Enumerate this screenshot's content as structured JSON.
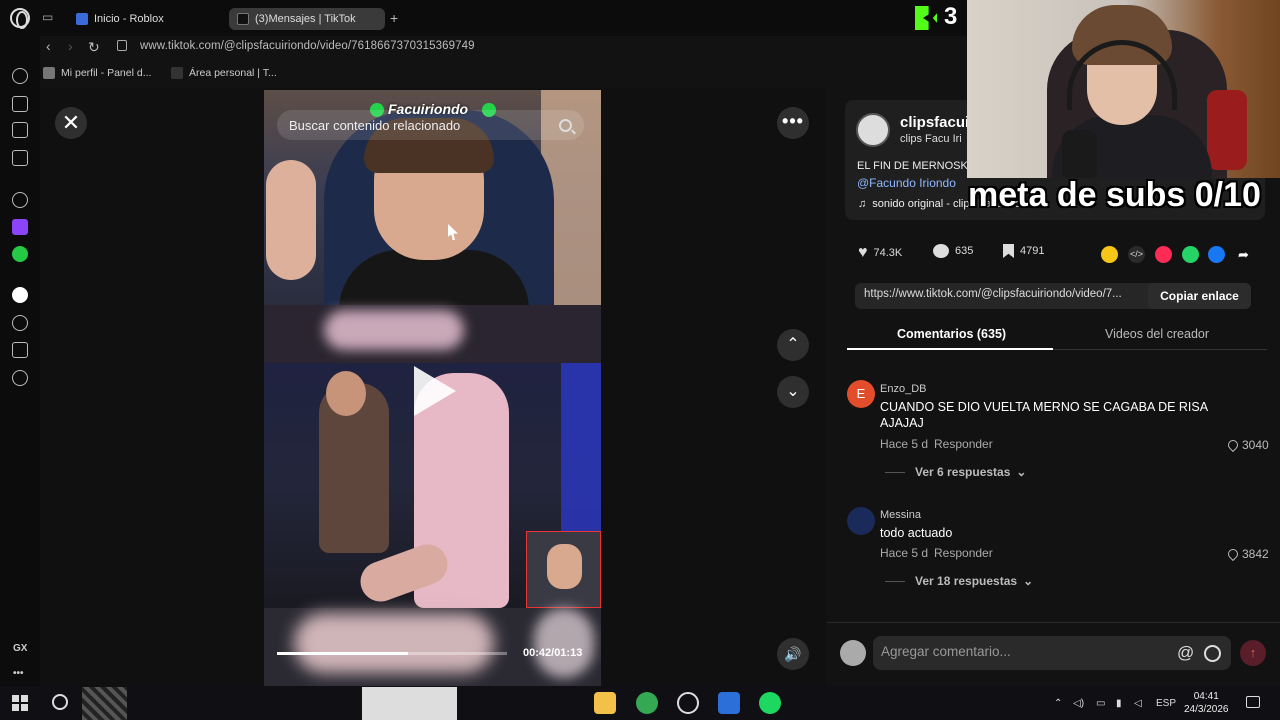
{
  "browser": {
    "tabs": [
      {
        "label": "Inicio - Roblox"
      },
      {
        "label": "(3)Mensajes | TikTok"
      }
    ],
    "new_tab": "+",
    "url": "www.tiktok.com/@clipsfacuiriondo/video/7618667370315369749",
    "bookmarks": [
      {
        "label": "Mi perfil - Panel d..."
      },
      {
        "label": "Área personal | T..."
      }
    ],
    "sidebar_gx": "GX",
    "sidebar_more": "•••"
  },
  "video": {
    "watermark_name": "Facuiriondo",
    "search_placeholder": "Buscar contenido relacionado",
    "progress_fraction": 0.57,
    "time": "00:42/01:13"
  },
  "controls": {
    "close": "✕",
    "more": "•••",
    "up": "⌃",
    "down": "⌄",
    "volume": "🔊"
  },
  "author": {
    "username": "clipsfacui",
    "nickname": "clips Facu Iri",
    "description": "EL FIN DE MERNOSK",
    "mention": "@Facundo Iriondo",
    "sound": "sonido original - clips Facu Iriondo"
  },
  "stats": {
    "likes": "74.3K",
    "comments": "635",
    "saves": "4791"
  },
  "link": {
    "url": "https://www.tiktok.com/@clipsfacuiriondo/video/7...",
    "copy_label": "Copiar enlace"
  },
  "tabs": {
    "comments": "Comentarios (635)",
    "creator_videos": "Videos del creador"
  },
  "comments": [
    {
      "avatar": "E",
      "user": "Enzo_DB",
      "text": "CUANDO SE DIO VUELTA MERNO SE CAGABA DE RISA AJAJAJ",
      "age": "Hace 5 d",
      "reply": "Responder",
      "likes": "3040",
      "replies": "Ver 6 respuestas"
    },
    {
      "avatar": "",
      "user": "Messina",
      "text": "todo actuado",
      "age": "Hace 5 d",
      "reply": "Responder",
      "likes": "3842",
      "replies": "Ver 18 respuestas"
    }
  ],
  "comment_input": {
    "placeholder": "Agregar comentario...",
    "at": "@"
  },
  "overlay": {
    "kick_count": "3",
    "meta_subs": "meta de subs 0/10"
  },
  "taskbar": {
    "lang": "ESP",
    "time": "04:41",
    "date": "24/3/2026"
  },
  "colors": {
    "accent_pink": "#fe2c55",
    "kick_green": "#53fc18",
    "mention_blue": "#8fb7ff"
  }
}
